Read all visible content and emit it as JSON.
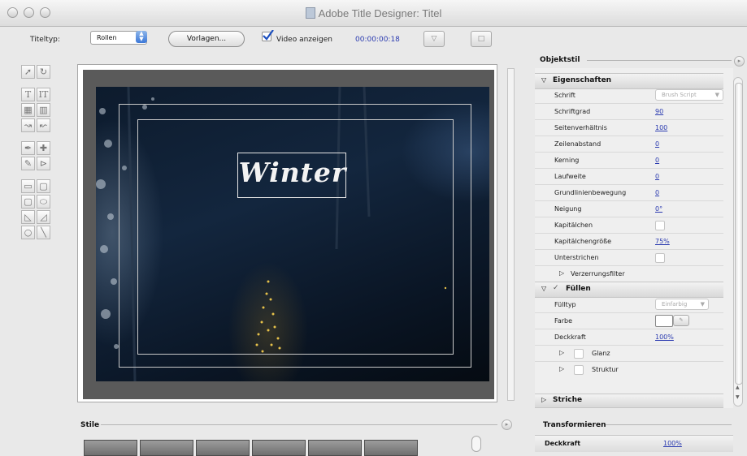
{
  "window": {
    "title": "Adobe Title Designer: Titel"
  },
  "toolbar": {
    "titletype_label": "Titeltyp:",
    "titletype_value": "Rollen",
    "templates_button": "Vorlagen...",
    "show_video_label": "Video anzeigen",
    "timecode": "00:00:00:18"
  },
  "canvas": {
    "title_text": "Winter"
  },
  "object_style": {
    "panel_title": "Objektstil",
    "properties_header": "Eigenschaften",
    "properties": [
      {
        "label": "Schrift",
        "value": "Brush Script"
      },
      {
        "label": "Schriftgrad",
        "value": "90"
      },
      {
        "label": "Seitenverhältnis",
        "value": "100"
      },
      {
        "label": "Zeilenabstand",
        "value": "0"
      },
      {
        "label": "Kerning",
        "value": "0"
      },
      {
        "label": "Laufweite",
        "value": "0"
      },
      {
        "label": "Grundlinienbewegung",
        "value": "0"
      },
      {
        "label": "Neigung",
        "value": "0°"
      },
      {
        "label": "Kapitälchen",
        "value": ""
      },
      {
        "label": "Kapitälchengröße",
        "value": "75%"
      },
      {
        "label": "Unterstrichen",
        "value": ""
      }
    ],
    "distort_label": "Verzerrungsfilter",
    "fill_header": "Füllen",
    "fill": {
      "filltype_label": "Fülltyp",
      "filltype_value": "Einfarbig",
      "color_label": "Farbe",
      "opacity_label": "Deckkraft",
      "opacity_value": "100%",
      "sheen_label": "Glanz",
      "texture_label": "Struktur"
    },
    "strokes_header": "Striche"
  },
  "styles": {
    "panel_title": "Stile"
  },
  "transform": {
    "panel_title": "Transformieren",
    "opacity_label": "Deckkraft",
    "opacity_value": "100%"
  },
  "colors": {
    "accent": "#3b78d8",
    "link": "#2b3bb0"
  }
}
